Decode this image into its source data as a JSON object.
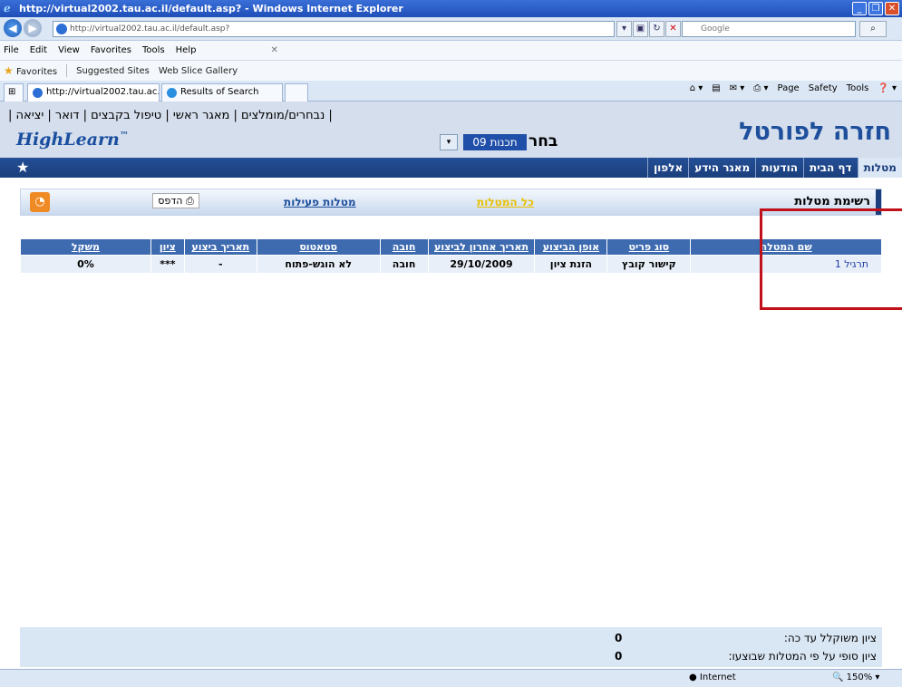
{
  "window": {
    "title": "http://virtual2002.tau.ac.il/default.asp? - Windows Internet Explorer"
  },
  "browser": {
    "address": "http://virtual2002.tau.ac.il/default.asp?",
    "search_placeholder": "Google",
    "menu": [
      "File",
      "Edit",
      "View",
      "Favorites",
      "Tools",
      "Help"
    ],
    "favorites_label": "Favorites",
    "favorites_items": [
      "Suggested Sites",
      "Web Slice Gallery"
    ],
    "tabs": [
      "http://virtual2002.tau.ac...",
      "Results of Search"
    ],
    "toolbar_right": [
      "Page",
      "Safety",
      "Tools"
    ],
    "status_zone": "Internet",
    "zoom": "150%"
  },
  "portal": {
    "top_links": "| נבחרים/מומלצים | מאגר ראשי | טיפול בקבצים | דואר | יציאה |",
    "logo": "HighLearn",
    "select_label": "בחר",
    "select_value": "תכנות 09",
    "title": "חזרה לפורטל",
    "nav_tabs": [
      "מטלות",
      "דף הבית",
      "הודעות",
      "מאגר הידע",
      "אלפון"
    ]
  },
  "tasks": {
    "title": "רשימת מטלות",
    "all_tasks_link": "כל המטלות",
    "active_tasks_link": "מטלות פעילות",
    "print_label": "הדפס",
    "columns": [
      "שם המטלה",
      "סוג פריט",
      "אופן הביצוע",
      "תאריך אחרון לביצוע",
      "חובה",
      "סטאטוס",
      "תאריך ביצוע",
      "ציון",
      "משקל"
    ],
    "rows": [
      [
        "תרגיל 1",
        "קישור קובץ",
        "הזנת ציון",
        "29/10/2009",
        "חובה",
        "לא הוגש-פתוח",
        "-",
        "***",
        "0%"
      ]
    ]
  },
  "summary": {
    "weighted_label": "ציון משוקלל עד כה:",
    "weighted_value": "0",
    "final_label": "ציון סופי על פי המטלות שבוצעו:",
    "final_value": "0"
  },
  "colors": {
    "accent": "#1e4f9c",
    "highlight": "#c0101a",
    "rss": "#f08a24"
  }
}
